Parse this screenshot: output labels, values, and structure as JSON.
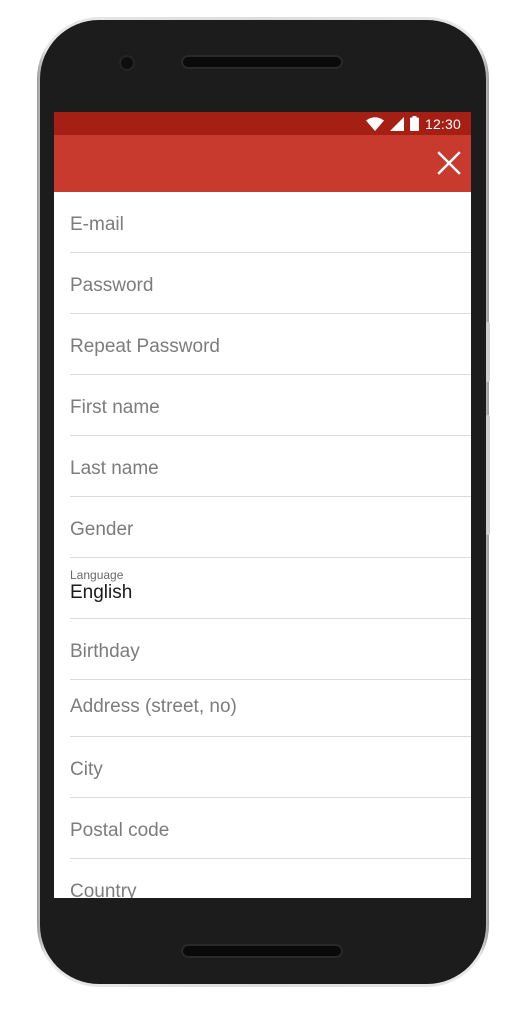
{
  "status_bar": {
    "time": "12:30",
    "icons": [
      "wifi-icon",
      "cellular-signal-icon",
      "battery-icon"
    ]
  },
  "app_bar": {
    "close_icon": "close-icon",
    "color": "#c83a2e",
    "status_color": "#a61f14"
  },
  "form": {
    "fields": [
      {
        "placeholder": "E-mail"
      },
      {
        "placeholder": "Password"
      },
      {
        "placeholder": "Repeat Password"
      },
      {
        "placeholder": "First name"
      },
      {
        "placeholder": "Last name"
      },
      {
        "placeholder": "Gender"
      },
      {
        "label": "Language",
        "value": "English"
      },
      {
        "placeholder": "Birthday"
      },
      {
        "placeholder": "Address (street, no)"
      },
      {
        "placeholder": "City"
      },
      {
        "placeholder": "Postal code"
      },
      {
        "placeholder": "Country"
      }
    ]
  }
}
